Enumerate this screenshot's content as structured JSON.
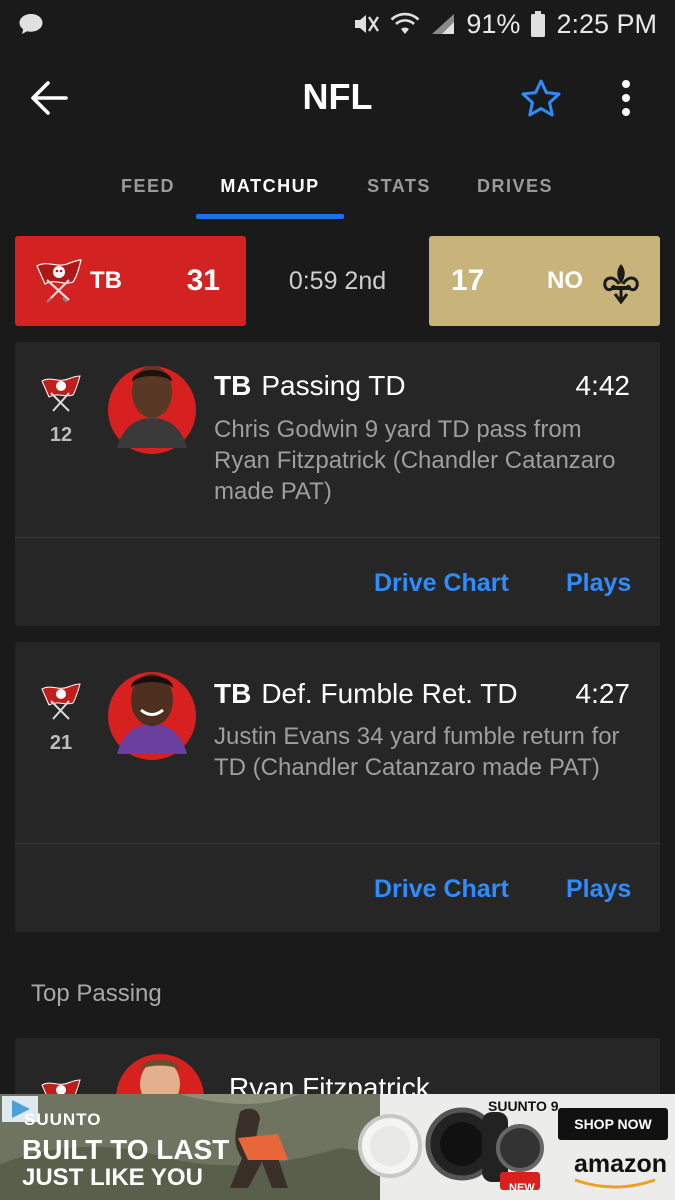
{
  "status_bar": {
    "battery": "91%",
    "time": "2:25 PM",
    "icons": [
      "chat-bubble-icon",
      "mute-icon",
      "wifi-icon",
      "signal-icon",
      "battery-icon"
    ]
  },
  "header": {
    "title": "NFL",
    "back_icon": "arrow-left-icon",
    "favorite_icon": "star-outline-icon",
    "menu_icon": "more-vertical-icon"
  },
  "tabs": [
    {
      "label": "FEED",
      "active": false
    },
    {
      "label": "MATCHUP",
      "active": true
    },
    {
      "label": "STATS",
      "active": false
    },
    {
      "label": "DRIVES",
      "active": false
    }
  ],
  "scoreboard": {
    "home": {
      "abbr": "TB",
      "score": "31",
      "color": "#d32222"
    },
    "clock": "0:59 2nd",
    "away": {
      "abbr": "NO",
      "score": "17",
      "color": "#c8b47a"
    }
  },
  "plays": [
    {
      "team": "TB",
      "drive_number": "12",
      "type": "Passing TD",
      "time": "4:42",
      "description": "Chris Godwin 9 yard TD pass from Ryan Fitzpatrick (Chandler Catanzaro made PAT)",
      "drive_chart_label": "Drive Chart",
      "plays_label": "Plays"
    },
    {
      "team": "TB",
      "drive_number": "21",
      "type": "Def. Fumble Ret. TD",
      "time": "4:27",
      "description": "Justin Evans 34 yard fumble return for TD (Chandler Catanzaro made PAT)",
      "drive_chart_label": "Drive Chart",
      "plays_label": "Plays"
    }
  ],
  "top_passing": {
    "label": "Top Passing",
    "player_name": "Ryan Fitzpatrick"
  },
  "ad": {
    "brand": "SUUNTO",
    "headline_1": "BUILT TO LAST",
    "headline_2": "JUST LIKE YOU",
    "product": "SUUNTO 9",
    "badge": "NEW",
    "cta": "SHOP NOW",
    "retailer": "amazon"
  },
  "colors": {
    "accent": "#1a73e8",
    "link": "#2f8cff",
    "background": "#1a1a1a",
    "card": "#262626"
  }
}
